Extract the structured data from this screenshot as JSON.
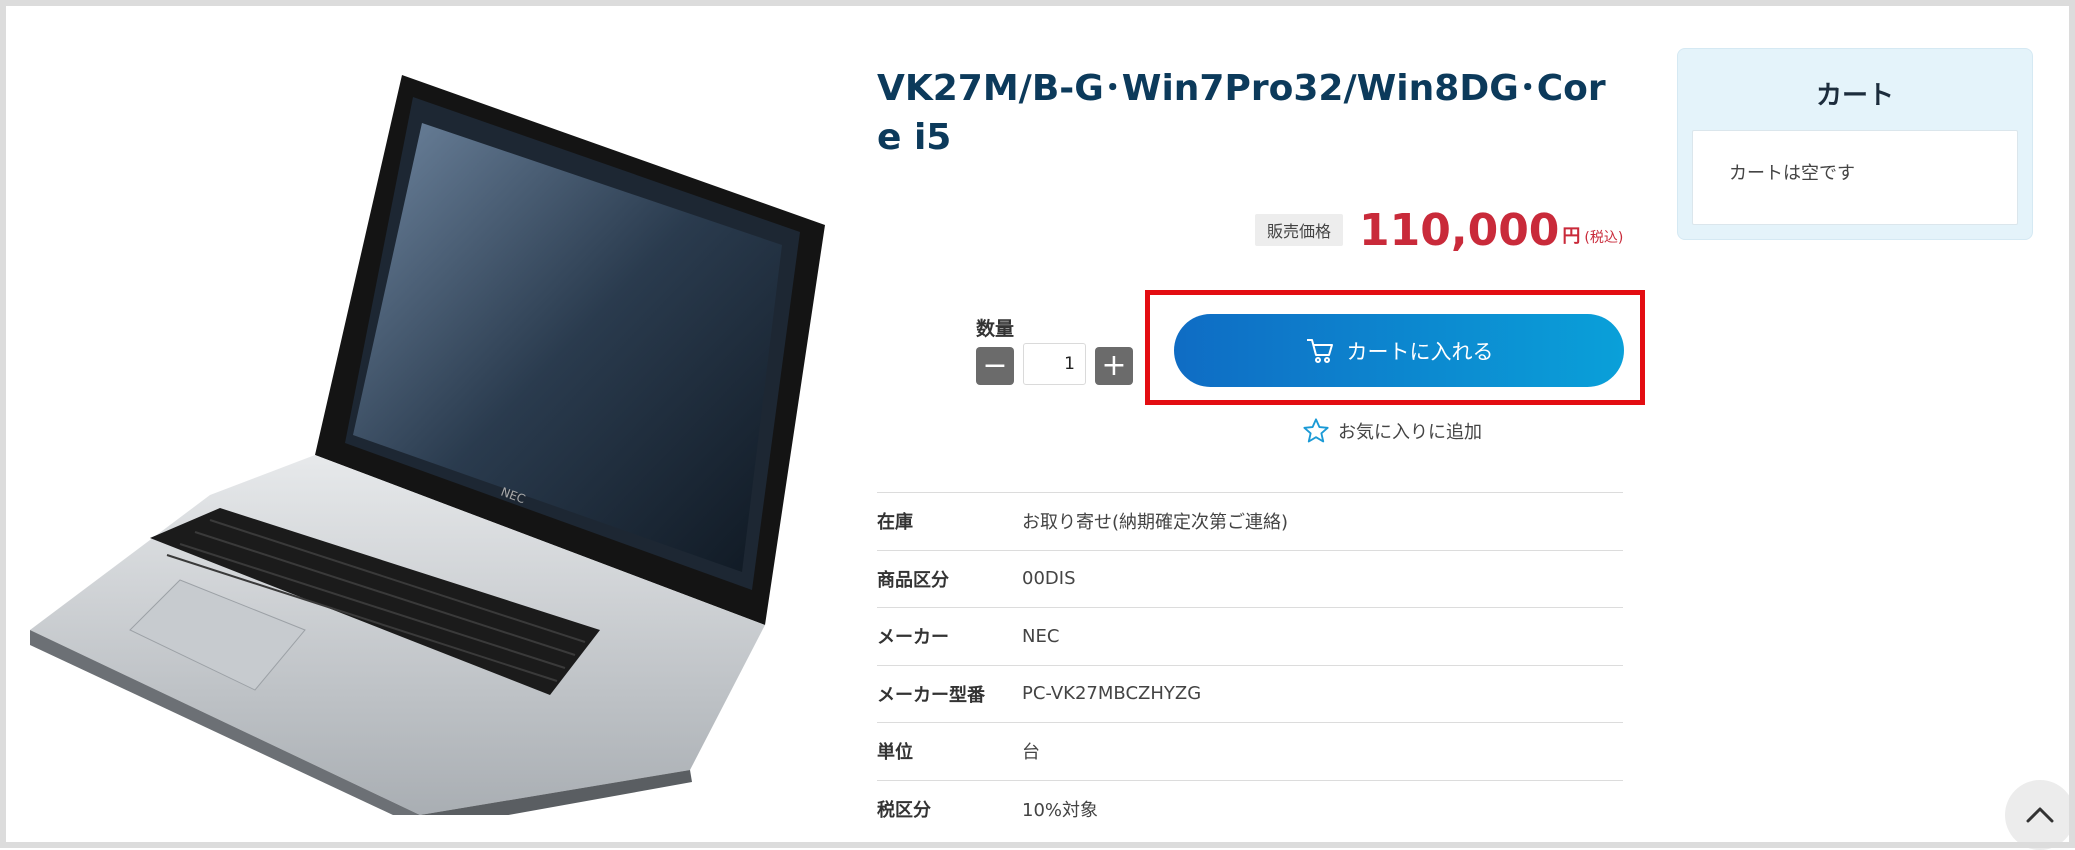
{
  "product": {
    "title": "VK27M/B-G･Win7Pro32/Win8DG･Core i5",
    "image_alt": "NEC laptop",
    "price_label": "販売価格",
    "price": "110,000",
    "price_unit": "円",
    "price_tax": "(税込)"
  },
  "quantity": {
    "label": "数量",
    "value": "1",
    "minus_symbol": "−",
    "plus_symbol": "+"
  },
  "actions": {
    "add_to_cart": "カートに入れる",
    "add_to_favorites": "お気に入りに追加"
  },
  "specs": [
    {
      "label": "在庫",
      "value": "お取り寄せ(納期確定次第ご連絡)"
    },
    {
      "label": "商品区分",
      "value": "00DIS"
    },
    {
      "label": "メーカー",
      "value": "NEC"
    },
    {
      "label": "メーカー型番",
      "value": "PC-VK27MBCZHYZG"
    },
    {
      "label": "単位",
      "value": "台"
    },
    {
      "label": "税区分",
      "value": "10%対象"
    }
  ],
  "cart": {
    "title": "カート",
    "empty_message": "カートは空です"
  },
  "colors": {
    "title": "#0c3a5b",
    "price": "#c92a3a",
    "button_start": "#0f6cc4",
    "button_end": "#0aa0d9",
    "highlight": "#e30d12",
    "cart_panel_bg": "#e4f3fa"
  },
  "icons": [
    "cart-icon",
    "star-icon",
    "chevron-up-icon"
  ]
}
